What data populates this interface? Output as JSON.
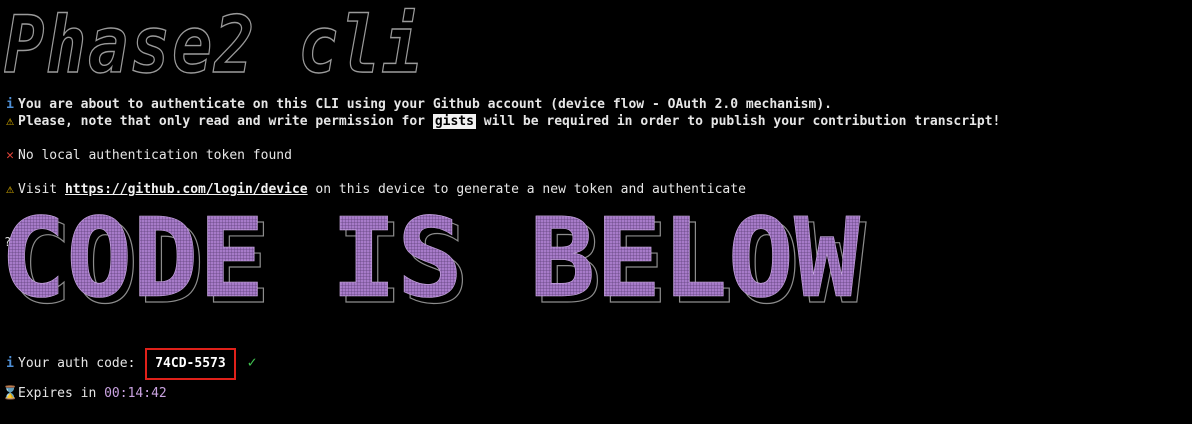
{
  "banner_top": {
    "text": "Phase2 cli"
  },
  "messages": {
    "about": "You are about to authenticate on this CLI using your Github account (device flow - OAuth 2.0 mechanism).",
    "note_before": "Please, note that only read and write permission for ",
    "note_gists": "gists",
    "note_after": " will be required in order to publish your contribution transcript!",
    "no_token": "No local authentication token found",
    "visit_before": "Visit ",
    "visit_link": "https://github.com/login/device",
    "visit_after": " on this device to generate a new token and authenticate"
  },
  "banner_code": {
    "text": "CODE IS BELOW",
    "prefix": "??"
  },
  "auth": {
    "label": "Your auth code:",
    "code": "74CD-5573",
    "check": "✓",
    "expires_label": "Expires in",
    "expires_value": "00:14:42"
  },
  "icons": {
    "info": "i",
    "warn": "⚠",
    "error": "✕",
    "hourglass": "⌛"
  },
  "colors": {
    "background": "#000000",
    "text": "#e6e6e6",
    "info": "#4e8fd6",
    "warning": "#f2c200",
    "error": "#e0443a",
    "check": "#3fbf4f",
    "banner_purple": "#a77bc9",
    "timer": "#c9a2e0",
    "highlight_box": "#e0211a"
  }
}
